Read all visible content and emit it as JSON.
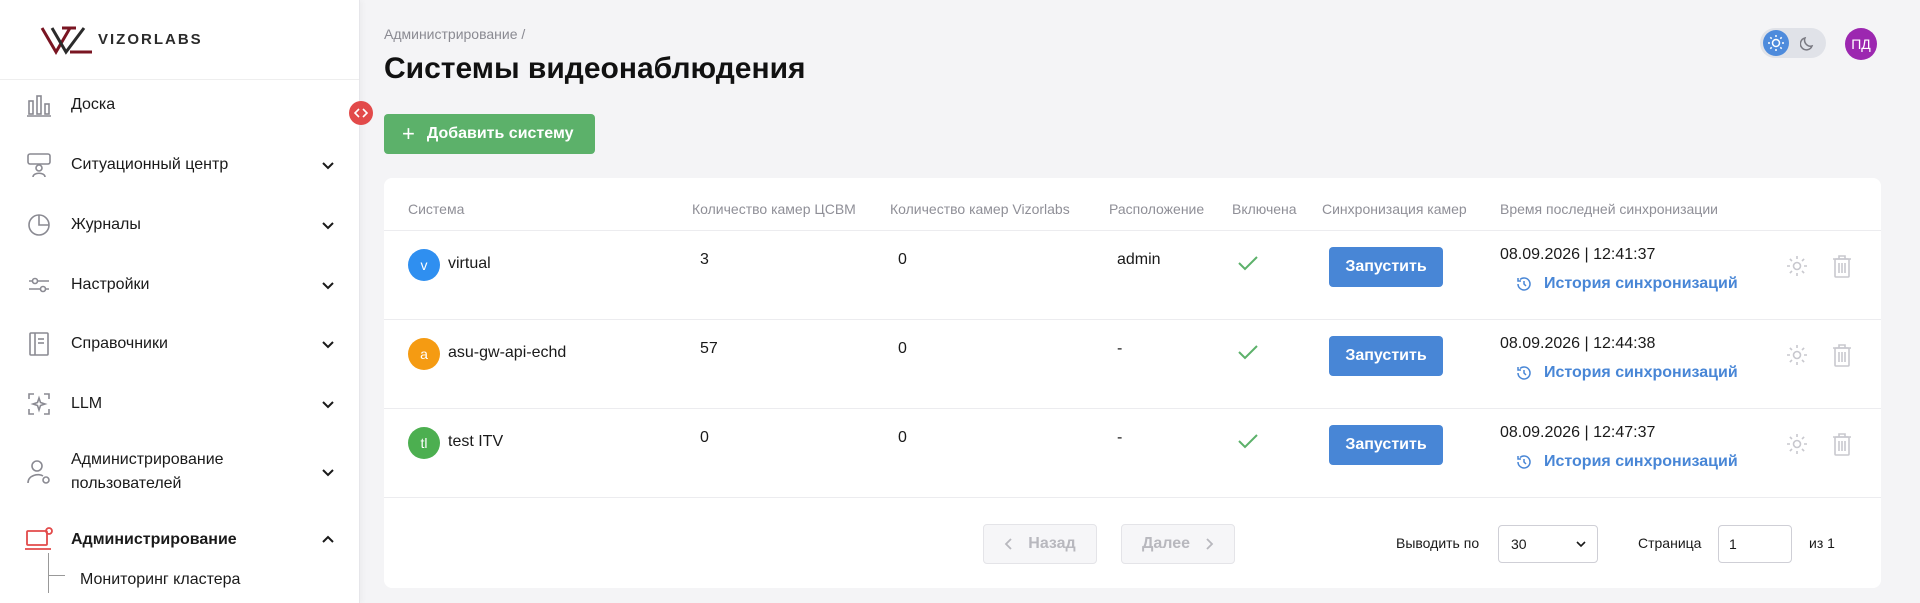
{
  "logo": {
    "text": "VIZORLABS"
  },
  "sidebar": {
    "items": [
      {
        "label": "Доска",
        "icon": "bar-chart-icon",
        "expandable": false
      },
      {
        "label": "Ситуационный центр",
        "icon": "situation-center-icon",
        "expandable": true
      },
      {
        "label": "Журналы",
        "icon": "pie-chart-icon",
        "expandable": true
      },
      {
        "label": "Настройки",
        "icon": "sliders-icon",
        "expandable": true
      },
      {
        "label": "Справочники",
        "icon": "book-icon",
        "expandable": true
      },
      {
        "label": "LLM",
        "icon": "sparkle-icon",
        "expandable": true
      },
      {
        "label": "Администрирование\nпользователей",
        "icon": "user-settings-icon",
        "expandable": true
      },
      {
        "label": "Администрирование",
        "icon": "admin-laptop-icon",
        "expandable": true,
        "active": true
      }
    ],
    "subitems": [
      {
        "label": "Мониторинг кластера"
      }
    ]
  },
  "header": {
    "breadcrumb": "Администрирование /",
    "title": "Системы видеонаблюдения",
    "add_button": "Добавить систему",
    "user_initials": "ПД"
  },
  "table": {
    "columns": [
      "Система",
      "Количество камер ЦСВМ",
      "Количество камер Vizorlabs",
      "Расположение",
      "Включена",
      "Синхронизация камер",
      "Время последней синхронизации"
    ],
    "rows": [
      {
        "initial": "v",
        "avatar_color": "#2f8ff0",
        "name": "virtual",
        "cams_csvm": "3",
        "cams_vizor": "0",
        "location": "admin",
        "enabled": true,
        "run_label": "Запустить",
        "last_sync": "08.09.2026 | 12:41:37",
        "history_label": "История синхронизаций"
      },
      {
        "initial": "a",
        "avatar_color": "#f59b12",
        "name": "asu-gw-api-echd",
        "cams_csvm": "57",
        "cams_vizor": "0",
        "location": "-",
        "enabled": true,
        "run_label": "Запустить",
        "last_sync": "08.09.2026 | 12:44:38",
        "history_label": "История синхронизаций"
      },
      {
        "initial": "tl",
        "avatar_color": "#4caf50",
        "name": "test ITV",
        "cams_csvm": "0",
        "cams_vizor": "0",
        "location": "-",
        "enabled": true,
        "run_label": "Запустить",
        "last_sync": "08.09.2026 | 12:47:37",
        "history_label": "История синхронизаций"
      }
    ]
  },
  "pagination": {
    "prev_label": "Назад",
    "next_label": "Далее",
    "per_page_label": "Выводить по",
    "per_page_value": "30",
    "page_label": "Страница",
    "page_value": "1",
    "total_label": "из 1"
  },
  "colors": {
    "primary": "#4886d6",
    "success": "#5cb16a",
    "brand_dark": "#7a1522",
    "danger": "#e24a4a",
    "user_avatar": "#9c27b0"
  }
}
